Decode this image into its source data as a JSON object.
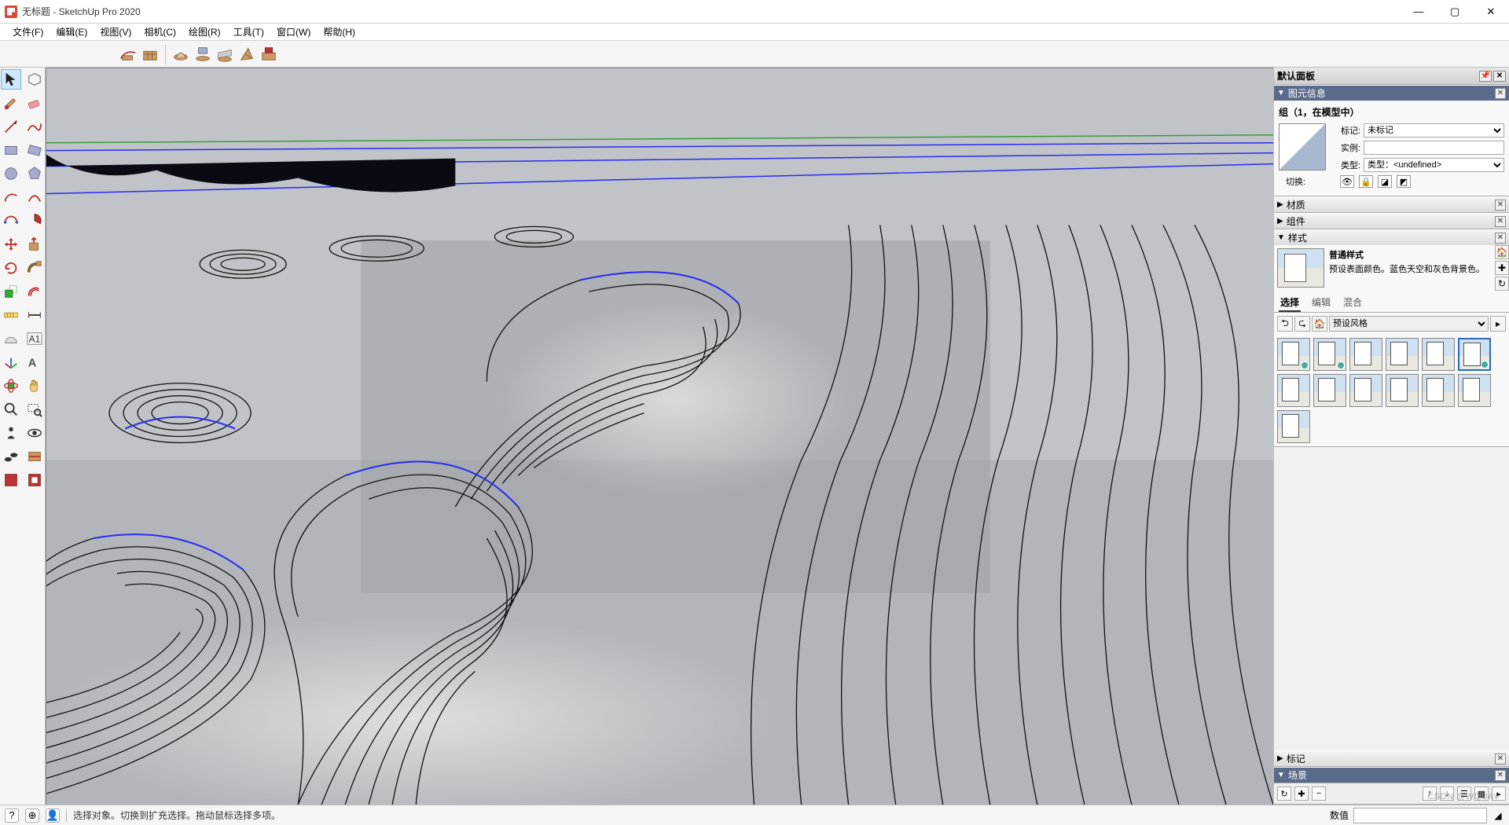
{
  "title": "无标题 - SketchUp Pro 2020",
  "menu": [
    "文件(F)",
    "编辑(E)",
    "视图(V)",
    "相机(C)",
    "绘图(R)",
    "工具(T)",
    "窗口(W)",
    "帮助(H)"
  ],
  "tb_groups": [
    [
      "sandbox-contour",
      "sandbox-scratch"
    ],
    [
      "sandbox-smoove",
      "sandbox-stamp",
      "sandbox-drape",
      "sandbox-detail",
      "sandbox-flip"
    ]
  ],
  "left_tools": [
    "select",
    "paint",
    "eraser",
    "line",
    "freehand",
    "tape",
    "rectangle",
    "circle",
    "arc",
    "pushpull",
    "2pt-arc",
    "pie",
    "curve",
    "polygon",
    "move",
    "rotate",
    "scale",
    "offset",
    "tape2",
    "text",
    "axes",
    "dim",
    "protractor",
    "section",
    "pan",
    "orbit",
    "zoom",
    "zoom-ext",
    "look",
    "walk",
    "position",
    "prev",
    "iso",
    "next",
    "style1",
    "style2"
  ],
  "tray": {
    "header": "默认面板",
    "entity": {
      "title": "图元信息",
      "group_line": "组（1，在模型中）",
      "tag_lbl": "标记:",
      "tag_val": "未标记",
      "inst_lbl": "实例:",
      "inst_val": "",
      "type_lbl": "类型:",
      "type_val": "类型：<undefined>",
      "toggle_lbl": "切换:"
    },
    "panels": {
      "materials": "材质",
      "components": "组件",
      "styles": "样式",
      "tags": "标记",
      "scenes": "场景"
    },
    "style": {
      "name": "普通样式",
      "desc": "预设表面颜色。蓝色天空和灰色背景色。",
      "tabs": [
        "选择",
        "编辑",
        "混合"
      ],
      "browse": "预设风格"
    }
  },
  "status": {
    "hint": "选择对象。切换到扩充选择。拖动鼠标选择多项。",
    "vcb_label": "数值"
  },
  "watermark": "CSDN @WQUAV"
}
